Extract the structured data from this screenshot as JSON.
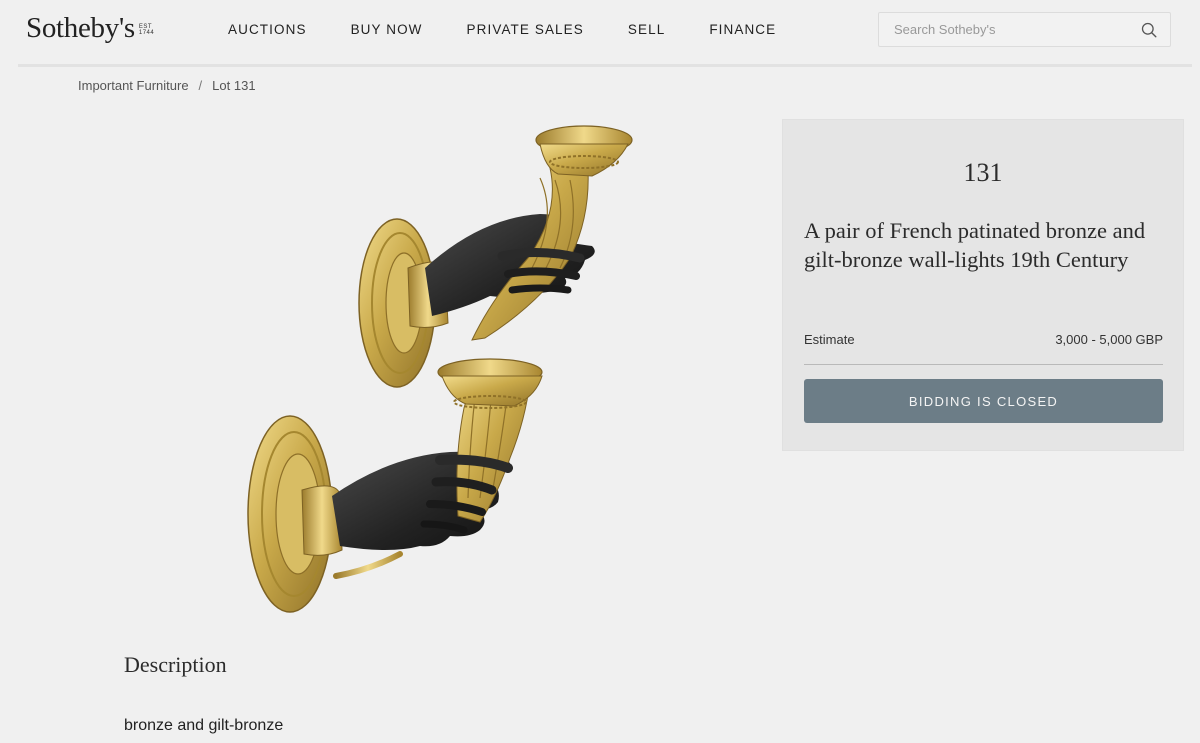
{
  "header": {
    "logo_text": "Sotheby's",
    "logo_est": [
      "EST",
      "1744"
    ],
    "nav": [
      "Auctions",
      "Buy Now",
      "Private Sales",
      "Sell",
      "Finance"
    ],
    "search": {
      "placeholder": "Search Sotheby's",
      "icon": "search-icon"
    }
  },
  "breadcrumb": {
    "items": [
      "Important Furniture",
      "Lot 131"
    ],
    "separator": "/"
  },
  "lot": {
    "number": "131",
    "title": "A pair of French patinated bronze and gilt-bronze wall-lights 19th Century",
    "estimate_label": "Estimate",
    "estimate_value": "3,000 - 5,000 GBP",
    "bid_button": "Bidding is Closed"
  },
  "description": {
    "heading": "Description",
    "text": "bronze and gilt-bronze"
  },
  "colors": {
    "background": "#f0f0f0",
    "panel": "#e5e5e5",
    "button": "#6c7d87",
    "gilt": "#c9a94a",
    "patina": "#2a2a2a"
  }
}
